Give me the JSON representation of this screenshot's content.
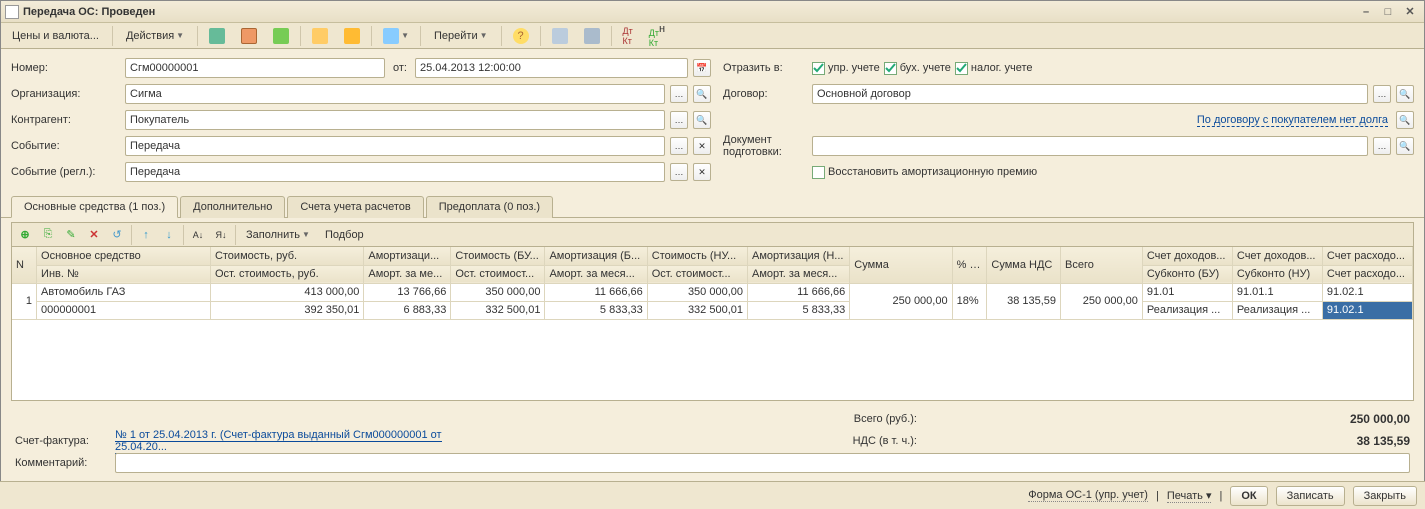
{
  "window": {
    "title": "Передача ОС: Проведен"
  },
  "menu": {
    "prices": "Цены и валюта...",
    "actions": "Действия",
    "goto": "Перейти"
  },
  "form": {
    "number_lbl": "Номер:",
    "number": "Сгм00000001",
    "date_lbl": "от:",
    "date": "25.04.2013 12:00:00",
    "org_lbl": "Организация:",
    "org": "Сигма",
    "contr_lbl": "Контрагент:",
    "contr": "Покупатель",
    "event_lbl": "Событие:",
    "event": "Передача",
    "event_reg_lbl": "Событие (регл.):",
    "event_reg": "Передача",
    "reflect_lbl": "Отразить в:",
    "chk_upr": "упр. учете",
    "chk_bux": "бух. учете",
    "chk_nal": "налог. учете",
    "contract_lbl": "Договор:",
    "contract": "Основной договор",
    "contract_note": "По договору с покупателем нет долга",
    "docprep_lbl1": "Документ",
    "docprep_lbl2": "подготовки:",
    "restore_chk": "Восстановить амортизационную премию"
  },
  "tabs": [
    "Основные средства (1 поз.)",
    "Дополнительно",
    "Счета учета расчетов",
    "Предоплата (0 поз.)"
  ],
  "gtbar": {
    "fill": "Заполнить",
    "pick": "Подбор"
  },
  "cols": {
    "n": "N",
    "os": "Основное средство",
    "inv": "Инв. №",
    "cost": "Стоимость, руб.",
    "rest": "Ост. стоимость, руб.",
    "amort": "Амортизаци...",
    "amort_m": "Аморт. за ме...",
    "cost_bu": "Стоимость (БУ...",
    "rest_bu": "Ост. стоимост...",
    "amort_bu": "Амортизация (Б...",
    "amort_bu_m": "Аморт. за меся...",
    "cost_nu": "Стоимость (НУ...",
    "rest_nu": "Ост. стоимост...",
    "amort_nu": "Амортизация (Н...",
    "amort_nu_m": "Аморт. за меся...",
    "sum": "Сумма",
    "vat_p": "% НДС",
    "vat_s": "Сумма НДС",
    "total": "Всего",
    "inc_bu": "Счет доходов...",
    "sub_bu": "Субконто (БУ)",
    "inc_nu": "Счет доходов...",
    "sub_nu": "Субконто (НУ)",
    "exp1": "Счет расходо...",
    "exp2": "Счет расходо..."
  },
  "row": {
    "n": "1",
    "os": "Автомобиль ГАЗ",
    "inv": "000000001",
    "cost": "413 000,00",
    "rest": "392 350,01",
    "amort": "13 766,66",
    "amort_m": "6 883,33",
    "cost_bu": "350 000,00",
    "rest_bu": "332 500,01",
    "amort_bu": "11 666,66",
    "amort_bu_m": "5 833,33",
    "cost_nu": "350 000,00",
    "rest_nu": "332 500,01",
    "amort_nu": "11 666,66",
    "amort_nu_m": "5 833,33",
    "sum": "250 000,00",
    "vat_p": "18%",
    "vat_s": "38 135,59",
    "total": "250 000,00",
    "inc_bu": "91.01",
    "sub_bu": "Реализация ...",
    "inc_nu": "91.01.1",
    "sub_nu": "Реализация ...",
    "exp1": "91.02.1",
    "exp2": "91.02.1"
  },
  "totals": {
    "total_lbl": "Всего (руб.):",
    "total": "250 000,00",
    "vat_lbl": "НДС (в т. ч.):",
    "vat": "38 135,59",
    "sf_lbl": "Счет-фактура:",
    "sf_link": "№ 1 от 25.04.2013 г. (Счет-фактура выданный Сгм000000001 от 25.04.20...",
    "comment_lbl": "Комментарий:"
  },
  "footer": {
    "form_os1": "Форма ОС-1 (упр. учет)",
    "print": "Печать",
    "ok": "ОК",
    "save": "Записать",
    "close": "Закрыть"
  }
}
